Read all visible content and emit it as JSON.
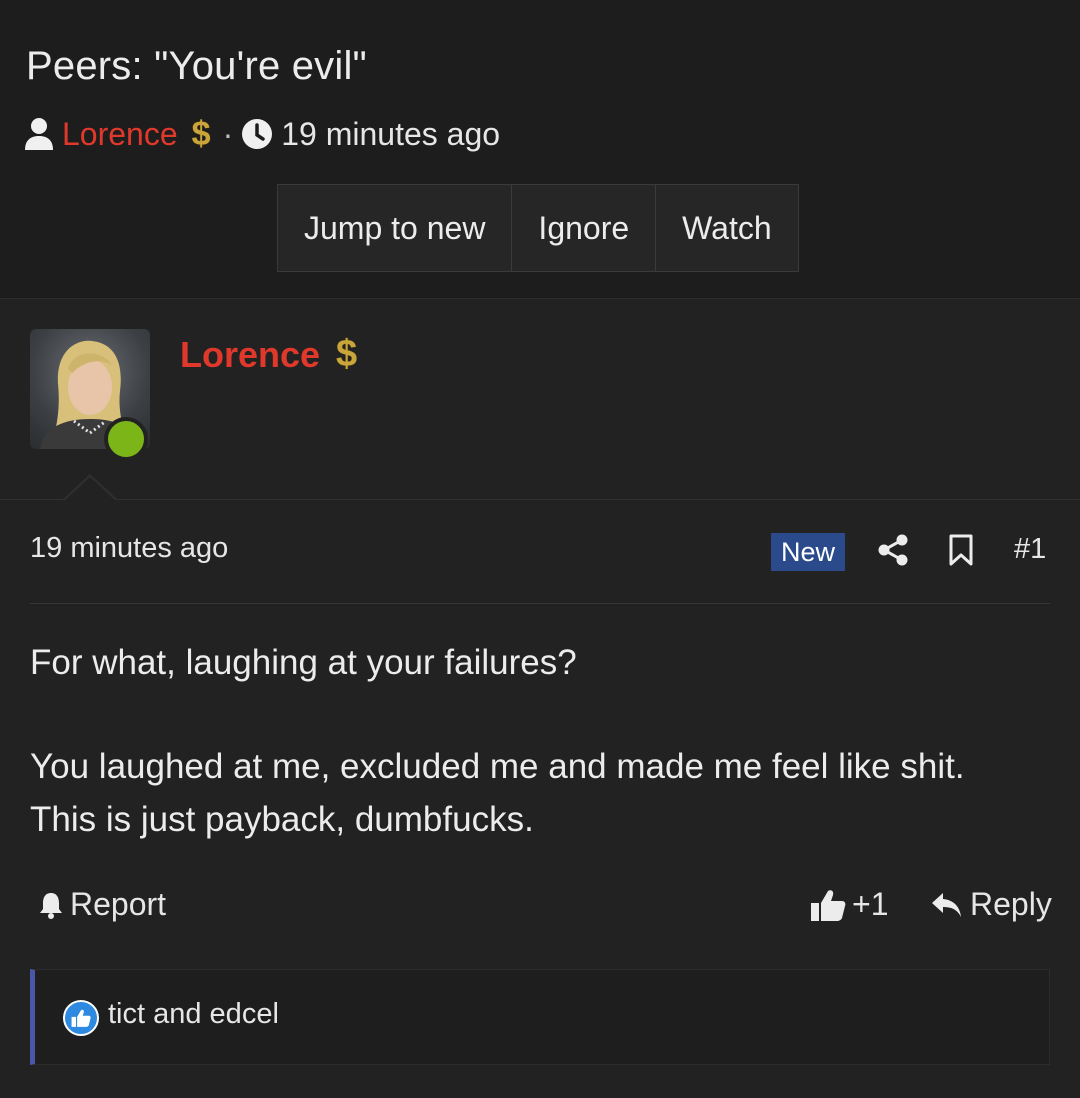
{
  "thread": {
    "title": "Peers: \"You're evil\"",
    "author": "Lorence",
    "author_badge": "$",
    "separator": "·",
    "time": "19 minutes ago"
  },
  "buttons": {
    "jump_label": "Jump to new",
    "ignore_label": "Ignore",
    "watch_label": "Watch"
  },
  "poster": {
    "name": "Lorence",
    "badge": "$",
    "online": true
  },
  "post": {
    "time": "19 minutes ago",
    "new_badge": "New",
    "number": "#1",
    "body": [
      "For what, laughing at your failures?",
      "You laughed at me, excluded me and made me feel like shit.",
      "This is just payback, dumbfucks."
    ],
    "report_label": "Report",
    "like_count": "+1",
    "reply_label": "Reply",
    "reactors": "tict and edcel"
  },
  "colors": {
    "author": "#e0392c",
    "badge_gold": "#c9a53a",
    "online": "#7cb518",
    "new_badge_bg": "#2a4a8c",
    "reaction_bar": "#4a56a8",
    "like_blue": "#2d8ae0"
  },
  "icons": [
    "user-icon",
    "clock-icon",
    "share-icon",
    "bookmark-icon",
    "bell-icon",
    "thumbs-up-icon",
    "reply-icon"
  ]
}
